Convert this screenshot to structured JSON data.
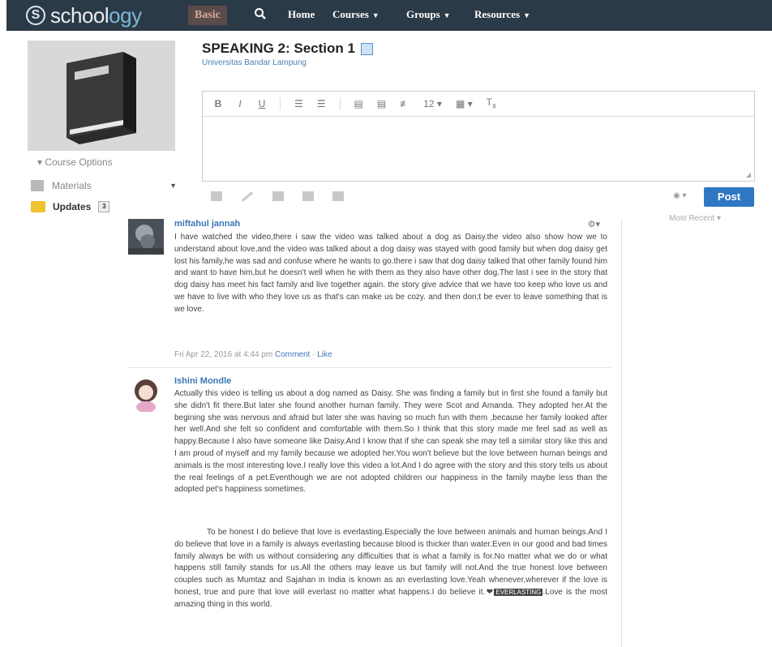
{
  "nav": {
    "logo_s": "S",
    "logo_text_a": "school",
    "logo_text_b": "ogy",
    "basic": "Basic",
    "home": "Home",
    "courses": "Courses",
    "groups": "Groups",
    "resources": "Resources"
  },
  "sidebar": {
    "course_options": "Course Options",
    "materials": "Materials",
    "updates": "Updates",
    "updates_count": "3"
  },
  "course": {
    "title": "SPEAKING 2: Section 1",
    "subtitle": "Universitas Bandar Lampung"
  },
  "editor": {
    "toolbar": [
      "B",
      "I",
      "U",
      "12"
    ],
    "post_label": "Post",
    "sort_label": "Most Recent"
  },
  "posts": [
    {
      "author": "miftahul jannah",
      "body": "I have watched the video,there i saw the video was talked about a dog as Daisy.the video also show how we to understand about love,and the video was talked about a dog daisy was stayed with good family but when dog daisy get lost his family,he was sad and confuse where he wants to go.there i saw that dog daisy talked that other family found him and want to have him,but he doesn't well when he with them as they also have other dog.The last i see in the story that dog daisy has meet his fact family and live together again. the story give advice that we have too keep who love us and we have to live with who they love us as that's can make us be cozy. and then don;t be ever to leave something that is we love.",
      "date": "Fri Apr 22, 2016 at 4:44 pm",
      "comment": "Comment",
      "like": "Like"
    },
    {
      "author": "Ishini Mondle",
      "body1": "Actually this video is telling us about a dog named as Daisy. She was finding a family but in first she found a family but she didn't fit there.But later she found another human family. They were Scot and Amanda. They adopted her.At the begining she was nervous and afraid but later she was having so much fun with them ,because her family looked after her well.And she felt so confident and comfortable with them.So I think that this story made me feel sad as well as happy.Because I also have someone like Daisy.And I know that if she can speak she may tell a similar story like this and I am proud of myself and my family because we adopted her.You won't believe but the love between human beings and animals is the most interesting love.I really love this video a lot.And I do agree with the story and this story tells us about the real feelings of a pet.Eventhough we are not adopted children our happiness in the family maybe less than the adopted pet's happiness sometimes.",
      "body2a": "To be honest I do believe that love is everlasting.Especially the love between animals and human beings.And I do believe that love in a family is always everlasting because blood is thicker than water.Even in our good and bad times family always be with us without considering any difficulties that is what a family is for.No matter what we do or what happens still family stands for us.All the others may leave us but family will not.And the true honest love between couples such as Mumtaz and Sajahan in India is known as an everlasting love.Yeah whenever,wherever if the love is honest, true and pure that love will everlast no matter what happens.I do believe it.",
      "highlight": "EVERLASTING",
      "body2b": ".Love is the most amazing thing in this world."
    }
  ]
}
